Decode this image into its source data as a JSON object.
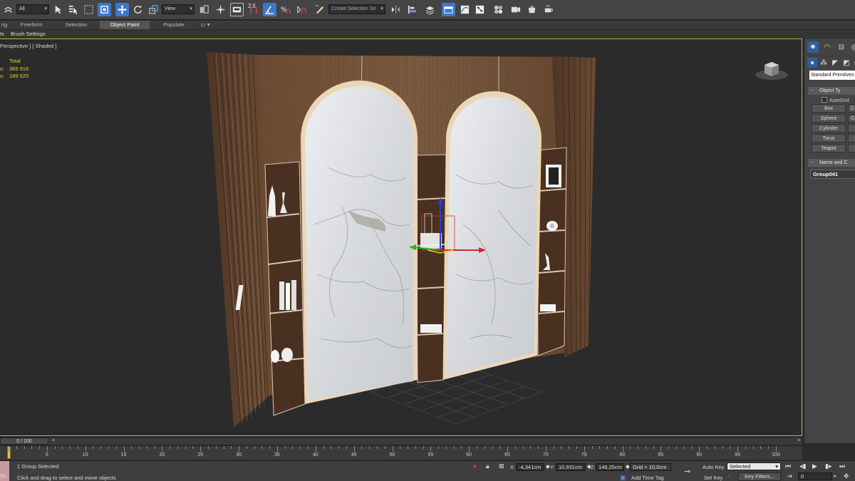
{
  "toolbar": {
    "selection_filter": "All",
    "reference_coord": "View",
    "snap_label": "2.5",
    "named_selection_placeholder": "Create Selection Se",
    "colors": {
      "active": "#3c78c8",
      "background": "#444444"
    }
  },
  "ribbon": {
    "tabs": [
      "ng",
      "Freeform",
      "Selection",
      "Object Paint",
      "Populate"
    ],
    "active_tab": "Object Paint",
    "sub_items": [
      "ts",
      "Brush Settings"
    ]
  },
  "viewport": {
    "label": "Perspective ] [ Shaded ]",
    "stats": {
      "header": "Total",
      "rows": [
        {
          "key": "s:",
          "value": "365 916"
        },
        {
          "key": "s:",
          "value": "189 620"
        }
      ]
    },
    "border_color": "#c9b15a"
  },
  "command_panel": {
    "dropdown": "Standard Primitives",
    "object_type_label": "Object Ty",
    "autogrid_label": "AutoGrid",
    "buttons": [
      "Box",
      "Sphere",
      "Cylinder",
      "Torus",
      "Teapot"
    ],
    "buttons_right": [
      "C",
      "G",
      "",
      "",
      ""
    ],
    "name_color_label": "Name and C",
    "object_name": "Group041"
  },
  "timeline": {
    "frame_display": "0 / 100",
    "prev_arrow": "<",
    "next_arrow": ">",
    "ticks": [
      5,
      10,
      15,
      20,
      25,
      30,
      35,
      40,
      45,
      50,
      55,
      60,
      65,
      70,
      75,
      80,
      85,
      90,
      95,
      100
    ]
  },
  "status": {
    "selection_text": "1 Group Selected",
    "prompt_text": "Click and drag to select and move objects",
    "left_box": "ML:",
    "x_label": "X:",
    "x_value": "-4,341cm",
    "y_label": "Y:",
    "y_value": "10,931cm",
    "z_label": "Z:",
    "z_value": "146,25cm",
    "grid_text": "Grid = 10,0cm",
    "add_time_tag": "Add Time Tag",
    "auto_key": "Auto Key",
    "auto_key_mode": "Selected",
    "set_key": "Set Key",
    "key_filters": "Key Filters...",
    "frame_value": "0"
  }
}
